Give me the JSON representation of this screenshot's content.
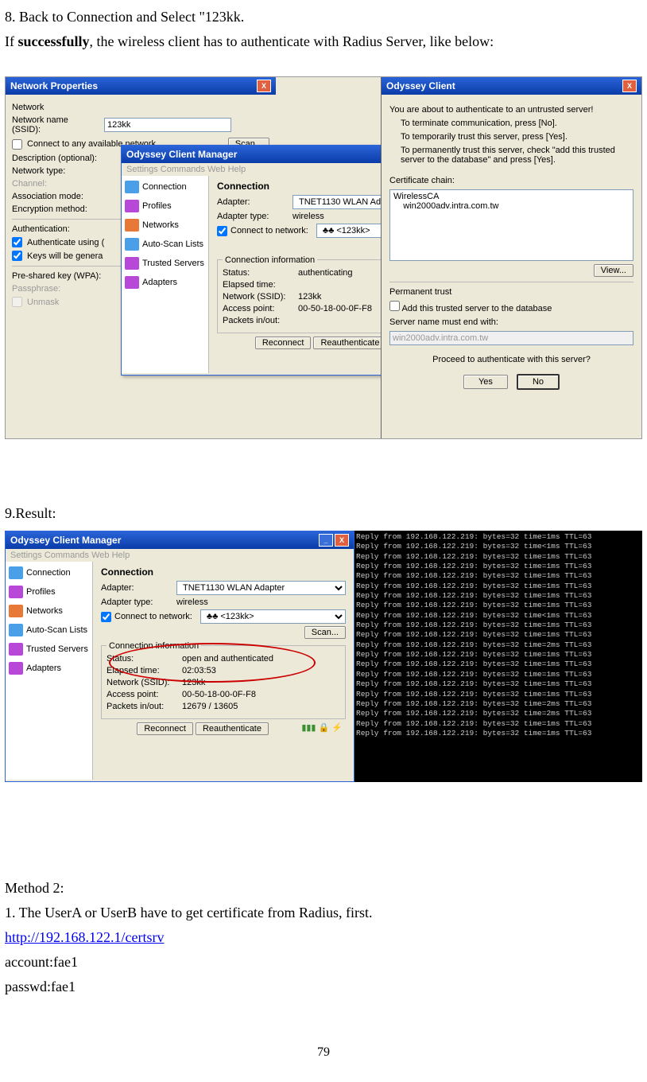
{
  "instructions": {
    "step8": "8. Back to Connection and Select \"123kk.",
    "step8_line2_prefix": "If ",
    "step8_bold": "successfully",
    "step8_line2_suffix": ", the wireless client has to authenticate with Radius Server, like below:",
    "step9": "9.Result:",
    "method2": "Method 2:",
    "method2_step1": "1. The UserA or UserB have to get certificate from Radius, first.",
    "url": "http://192.168.122.1/certsrv",
    "account": "account:fae1",
    "passwd": "passwd:fae1"
  },
  "page_number": "79",
  "netprops": {
    "title": "Network Properties",
    "network_label": "Network",
    "ssid_label": "Network name (SSID):",
    "ssid_value": "123kk",
    "connect_any": "Connect to any available network",
    "scan": "Scan...",
    "description_label": "Description (optional):",
    "network_type_label": "Network type:",
    "channel_label": "Channel:",
    "assoc_label": "Association mode:",
    "encrypt_label": "Encryption method:",
    "auth_label": "Authentication:",
    "auth_using": "Authenticate using (",
    "keys_gen": "Keys will be genera",
    "psk_label": "Pre-shared key (WPA):",
    "passphrase_label": "Passphrase:",
    "unmask_label": "Unmask"
  },
  "ocm": {
    "title": "Odyssey Client Manager",
    "menu": "Settings   Commands   Web   Help",
    "side_connection": "Connection",
    "side_profiles": "Profiles",
    "side_networks": "Networks",
    "side_autoscan": "Auto-Scan Lists",
    "side_trusted": "Trusted Servers",
    "side_adapters": "Adapters",
    "heading": "Connection",
    "adapter_label": "Adapter:",
    "adapter_value": "TNET1130 WLAN Adapter",
    "adapter_type_label": "Adapter type:",
    "adapter_type_value": "wireless",
    "connect_net": "Connect to network:",
    "network_value": "<123kk>",
    "scan": "Scan...",
    "conn_info": "Connection information",
    "status_label": "Status:",
    "status_value1": "authenticating",
    "status_value2": "open and authenticated",
    "elapsed_label": "Elapsed time:",
    "elapsed_value2": "02:03:53",
    "ssid_label": "Network (SSID):",
    "ssid_value": "123kk",
    "ap_label": "Access point:",
    "ap_value": "00-50-18-00-0F-F8",
    "packets_label": "Packets in/out:",
    "packets_value2": "12679 / 13605",
    "reconnect": "Reconnect",
    "reauth": "Reauthenticate"
  },
  "auth": {
    "title": "Odyssey Client",
    "intro": "You are about to authenticate to an untrusted server!",
    "opt1": "To terminate communication, press [No].",
    "opt2": "To temporarily trust this server, press [Yes].",
    "opt3": "To permanently trust this server, check \"add this trusted server to the database\" and press [Yes].",
    "cert_label": "Certificate chain:",
    "cert_value": "WirelessCA\n    win2000adv.intra.com.tw",
    "view": "View...",
    "perm_label": "Permanent trust",
    "add_check": "Add this trusted server to the database",
    "server_name": "Server name must end with:",
    "server_value": "win2000adv.intra.com.tw",
    "proceed": "Proceed to authenticate with this server?",
    "yes": "Yes",
    "no": "No"
  },
  "console": {
    "lines": [
      "Reply from 192.168.122.219: bytes=32 time=1ms TTL=63",
      "Reply from 192.168.122.219: bytes=32 time<1ms TTL=63",
      "Reply from 192.168.122.219: bytes=32 time=1ms TTL=63",
      "Reply from 192.168.122.219: bytes=32 time=1ms TTL=63",
      "Reply from 192.168.122.219: bytes=32 time=1ms TTL=63",
      "Reply from 192.168.122.219: bytes=32 time=1ms TTL=63",
      "Reply from 192.168.122.219: bytes=32 time=1ms TTL=63",
      "Reply from 192.168.122.219: bytes=32 time=1ms TTL=63",
      "Reply from 192.168.122.219: bytes=32 time<1ms TTL=63",
      "Reply from 192.168.122.219: bytes=32 time=1ms TTL=63",
      "Reply from 192.168.122.219: bytes=32 time=1ms TTL=63",
      "Reply from 192.168.122.219: bytes=32 time=2ms TTL=63",
      "Reply from 192.168.122.219: bytes=32 time=1ms TTL=63",
      "Reply from 192.168.122.219: bytes=32 time=1ms TTL=63",
      "Reply from 192.168.122.219: bytes=32 time=1ms TTL=63",
      "Reply from 192.168.122.219: bytes=32 time=1ms TTL=63",
      "Reply from 192.168.122.219: bytes=32 time=1ms TTL=63",
      "Reply from 192.168.122.219: bytes=32 time=2ms TTL=63",
      "Reply from 192.168.122.219: bytes=32 time=2ms TTL=63",
      "Reply from 192.168.122.219: bytes=32 time=1ms TTL=63",
      "Reply from 192.168.122.219: bytes=32 time=1ms TTL=63"
    ]
  }
}
